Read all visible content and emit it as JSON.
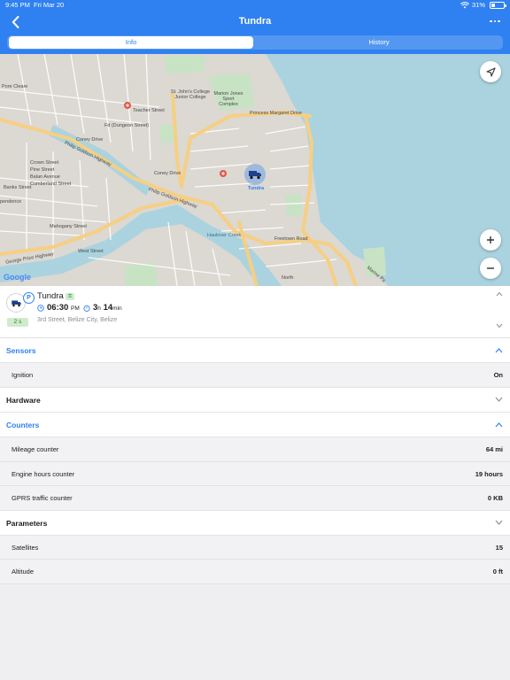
{
  "status_bar": {
    "time": "9:45 PM",
    "date": "Fri Mar 20",
    "battery": "31%"
  },
  "header": {
    "title": "Tundra",
    "tabs": [
      "Info",
      "History"
    ],
    "active_tab": "Info"
  },
  "map": {
    "labels": {
      "pore_cleare": "Pore Cleare",
      "teacher_street": "Teacher Street",
      "st_johns": "St. John's College Junior College",
      "marion_jones": "Marion Jones Sport Complex",
      "princess_margaret": "Princess Margaret Drive",
      "dungeon_street": "Fd (Dungeon Street)",
      "coney_drive": "Coney Drive",
      "coney_drive_2": "Coney Drive",
      "philip_goldson_hwy": "Philip Goldson Highway",
      "philip_goldson_hwy_2": "Philip Goldson Highway",
      "crown_street": "Crown Street",
      "pine_street": "Pine Street",
      "balan_avenue": "Balan Avenue",
      "cumberland_street": "Cumberland Street",
      "banks_street": "Banks Street",
      "mahogany_street": "Mahogany Street",
      "haulover_creek": "Haulover Creek",
      "freetown_road": "Freetown Road",
      "west_street": "West Street",
      "pendence": "pendence",
      "george_price_hwy": "George Price Highway",
      "marine_pa": "Marine Pa",
      "north": "North",
      "google": "Google"
    },
    "vehicle_label": "Tundra"
  },
  "card": {
    "name": "Tundra",
    "parked_badge": "P",
    "speed": "2 s",
    "time": "06:30",
    "ampm": "PM",
    "duration_h": "3",
    "duration_h_unit": "h",
    "duration_m": "14",
    "duration_m_unit": "min",
    "address": "3rd Street, Belize City, Belize"
  },
  "sections": {
    "sensors": {
      "label": "Sensors",
      "rows": [
        {
          "key": "Ignition",
          "value": "On"
        }
      ]
    },
    "hardware": {
      "label": "Hardware"
    },
    "counters": {
      "label": "Counters",
      "rows": [
        {
          "key": "Mileage counter",
          "value": "64 mi"
        },
        {
          "key": "Engine hours counter",
          "value": "19 hours"
        },
        {
          "key": "GPRS traffic counter",
          "value": "0 KB"
        }
      ]
    },
    "parameters": {
      "label": "Parameters",
      "rows": [
        {
          "key": "Satellites",
          "value": "15"
        },
        {
          "key": "Altitude",
          "value": "0 ft"
        }
      ]
    }
  },
  "colors": {
    "accent": "#2f80f0",
    "water": "#aad3df",
    "road_major": "#f6cf83",
    "park": "#c8e3c4"
  }
}
